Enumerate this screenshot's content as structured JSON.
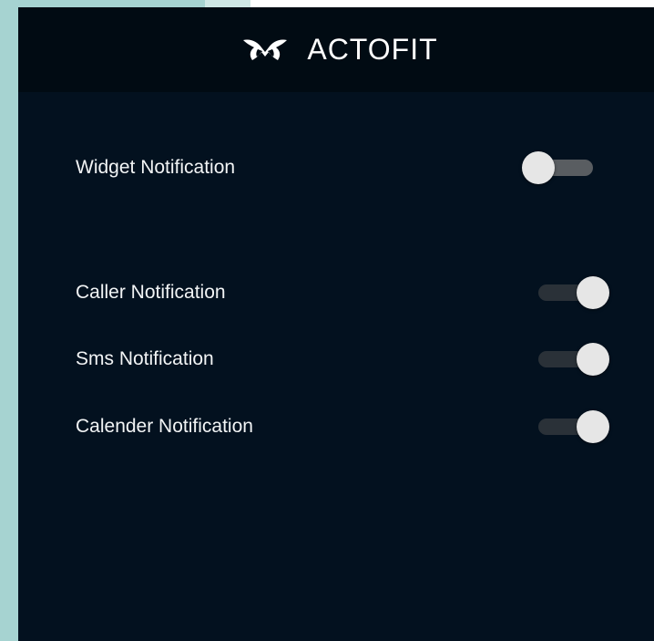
{
  "app": {
    "brand_name": "ACTOFIT",
    "logo_icon": "actofit-logo-icon"
  },
  "settings": {
    "widget": {
      "label": "Widget Notification",
      "enabled": false
    },
    "caller": {
      "label": "Caller Notification",
      "enabled": true
    },
    "sms": {
      "label": "Sms Notification",
      "enabled": true
    },
    "calender": {
      "label": "Calender Notification",
      "enabled": true
    }
  },
  "colors": {
    "background": "#03111f",
    "header": "#010b13",
    "text": "#f2f4f5",
    "thumb": "#e6e6e6",
    "track_off": "#595d61",
    "track_on": "#2a3138",
    "frame": "#a6d3d1"
  }
}
